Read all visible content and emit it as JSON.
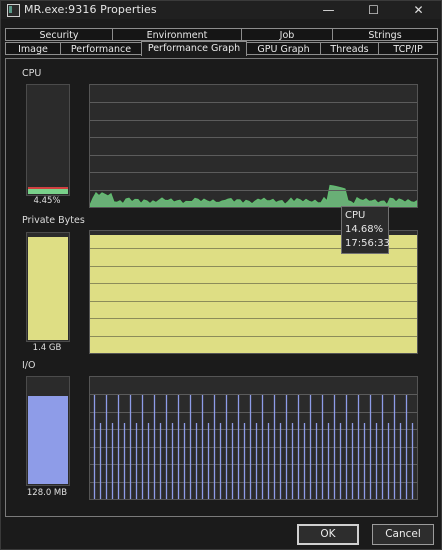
{
  "window": {
    "title": "MR.exe:9316 Properties",
    "minimize": "—",
    "maximize": "☐",
    "close": "✕"
  },
  "tabs": {
    "row1": [
      {
        "label": "Security"
      },
      {
        "label": "Environment"
      },
      {
        "label": "Job"
      },
      {
        "label": "Strings"
      }
    ],
    "row2": [
      {
        "label": "Image"
      },
      {
        "label": "Performance"
      },
      {
        "label": "Performance Graph",
        "active": true
      },
      {
        "label": "GPU Graph"
      },
      {
        "label": "Threads"
      },
      {
        "label": "TCP/IP"
      }
    ]
  },
  "sections": {
    "cpu": {
      "label": "CPU",
      "value": "4.45%",
      "level": 0.045,
      "color": "#79d18a"
    },
    "private": {
      "label": "Private Bytes",
      "value": "1.4 GB",
      "level": 0.97,
      "color": "#dede84"
    },
    "io": {
      "label": "I/O",
      "value": "128.0 MB",
      "level": 0.83,
      "color": "#8e9ce8"
    }
  },
  "tooltip": {
    "title": "CPU",
    "value": "14.68%",
    "time": "17:56:33"
  },
  "buttons": {
    "ok": "OK",
    "cancel": "Cancel"
  }
}
